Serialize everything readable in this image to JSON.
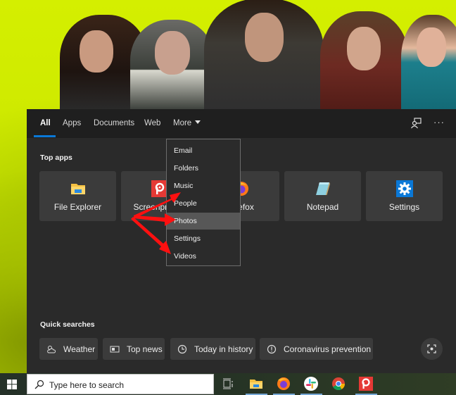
{
  "tabs": [
    {
      "label": "All",
      "active": true
    },
    {
      "label": "Apps"
    },
    {
      "label": "Documents"
    },
    {
      "label": "Web"
    },
    {
      "label": "More"
    }
  ],
  "toolbar": {
    "feedback_icon": "feedback-icon",
    "more_icon": "more-options-icon",
    "more_glyph": "···"
  },
  "top_apps": {
    "title": "Top apps",
    "items": [
      {
        "label": "File Explorer",
        "icon": "folder-icon"
      },
      {
        "label": "Screenpresso",
        "icon": "screenpresso-icon"
      },
      {
        "label": "Firefox",
        "icon": "firefox-icon"
      },
      {
        "label": "Notepad",
        "icon": "notepad-icon"
      },
      {
        "label": "Settings",
        "icon": "gear-icon"
      }
    ]
  },
  "more_menu": {
    "items": [
      "Email",
      "Folders",
      "Music",
      "People",
      "Photos",
      "Settings",
      "Videos"
    ],
    "highlighted": "Photos"
  },
  "quick_searches": {
    "title": "Quick searches",
    "items": [
      {
        "label": "Weather",
        "icon": "weather-icon"
      },
      {
        "label": "Top news",
        "icon": "news-icon"
      },
      {
        "label": "Today in history",
        "icon": "clock-icon"
      },
      {
        "label": "Coronavirus prevention",
        "icon": "info-icon"
      }
    ],
    "lens_icon": "visual-search-icon"
  },
  "taskbar": {
    "search_placeholder": "Type here to search",
    "pinned": [
      "task-view",
      "file-explorer",
      "firefox",
      "slack",
      "chrome",
      "screenpresso"
    ]
  },
  "colors": {
    "accent": "#0a78d7",
    "panel": "#2a2a2a",
    "annotation": "#ff0000"
  }
}
